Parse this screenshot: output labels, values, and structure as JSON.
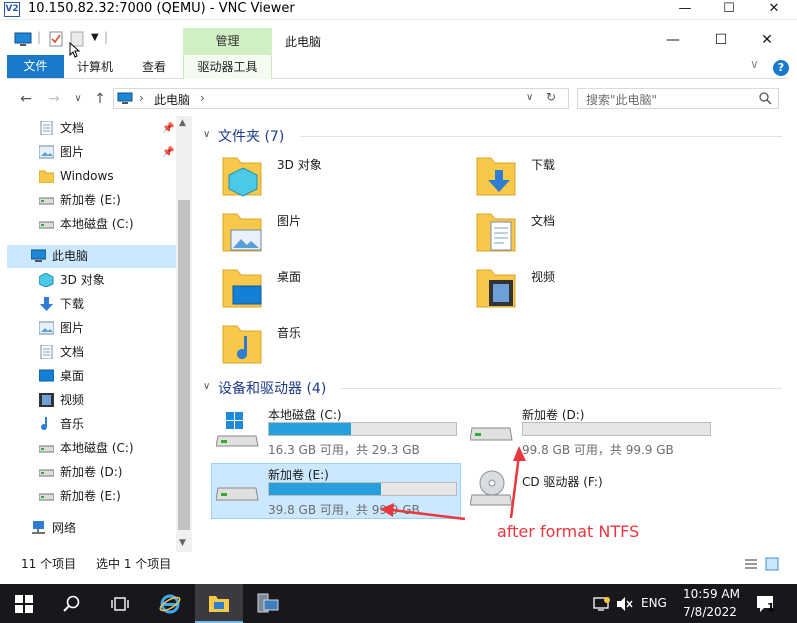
{
  "vnc": {
    "logo": "V2",
    "title": "10.150.82.32:7000 (QEMU) - VNC Viewer",
    "minimize": "—",
    "maximize": "☐",
    "close": "✕"
  },
  "explorer": {
    "window_title": "此电脑",
    "context_tab_header": "管理",
    "tabs": {
      "file": "文件",
      "computer": "计算机",
      "view": "查看",
      "drive_tools": "驱动器工具"
    },
    "win_controls": {
      "minimize": "—",
      "maximize": "☐",
      "close": "✕"
    },
    "help": "?",
    "ribbon_chevron": "∨",
    "address": {
      "icon": "this-pc-icon",
      "path": "此电脑",
      "sep": "›"
    },
    "search": {
      "placeholder": "搜索\"此电脑\""
    },
    "nav": {
      "quick_access": [
        {
          "label": "文档",
          "icon": "documents-icon",
          "pinned": true
        },
        {
          "label": "图片",
          "icon": "pictures-icon",
          "pinned": true
        },
        {
          "label": "Windows",
          "icon": "folder-icon",
          "pinned": false
        },
        {
          "label": "新加卷 (E:)",
          "icon": "drive-icon",
          "pinned": false
        },
        {
          "label": "本地磁盘 (C:)",
          "icon": "drive-icon",
          "pinned": false
        }
      ],
      "this_pc": {
        "label": "此电脑",
        "icon": "this-pc-icon"
      },
      "this_pc_children": [
        {
          "label": "3D 对象",
          "icon": "3d-objects-icon"
        },
        {
          "label": "下载",
          "icon": "downloads-icon"
        },
        {
          "label": "图片",
          "icon": "pictures-icon"
        },
        {
          "label": "文档",
          "icon": "documents-icon"
        },
        {
          "label": "桌面",
          "icon": "desktop-icon"
        },
        {
          "label": "视频",
          "icon": "videos-icon"
        },
        {
          "label": "音乐",
          "icon": "music-icon"
        },
        {
          "label": "本地磁盘 (C:)",
          "icon": "drive-icon"
        },
        {
          "label": "新加卷 (D:)",
          "icon": "drive-icon"
        },
        {
          "label": "新加卷 (E:)",
          "icon": "drive-icon"
        }
      ],
      "network": {
        "label": "网络",
        "icon": "network-icon"
      }
    },
    "folders_group": "文件夹 (7)",
    "folders": [
      {
        "name": "3D 对象",
        "icon": "3d-objects-icon"
      },
      {
        "name": "下载",
        "icon": "downloads-icon"
      },
      {
        "name": "图片",
        "icon": "pictures-icon"
      },
      {
        "name": "文档",
        "icon": "documents-icon"
      },
      {
        "name": "桌面",
        "icon": "desktop-icon"
      },
      {
        "name": "视频",
        "icon": "videos-icon"
      },
      {
        "name": "音乐",
        "icon": "music-icon"
      }
    ],
    "devices_group": "设备和驱动器 (4)",
    "drives": [
      {
        "name": "本地磁盘 (C:)",
        "size": "16.3 GB 可用，共 29.3 GB",
        "used_fraction": 0.44,
        "bar_color": "#26a0da",
        "icon": "windows-drive-icon"
      },
      {
        "name": "新加卷 (D:)",
        "size": "99.8 GB 可用，共 99.9 GB",
        "used_fraction": 0.0,
        "bar_color": "#26a0da",
        "icon": "drive-icon"
      },
      {
        "name": "新加卷 (E:)",
        "size": "39.8 GB 可用，共 99.9 GB",
        "used_fraction": 0.6,
        "bar_color": "#26a0da",
        "icon": "drive-icon",
        "selected": true
      },
      {
        "name": "CD 驱动器 (F:)",
        "size": "",
        "icon": "cd-drive-icon"
      }
    ],
    "status": {
      "count": "11 个项目",
      "selected": "选中 1 个项目"
    }
  },
  "annotation": {
    "text": "after format NTFS",
    "color": "#e8383d"
  },
  "taskbar": {
    "start": "start-icon",
    "search": "search-icon",
    "task_view": "task-view-icon",
    "ie": "ie-icon",
    "file_explorer": "file-explorer-icon",
    "server_manager": "server-manager-icon",
    "lang": "ENG",
    "time": "10:59 AM",
    "date": "7/8/2022",
    "notif_count": "1"
  }
}
